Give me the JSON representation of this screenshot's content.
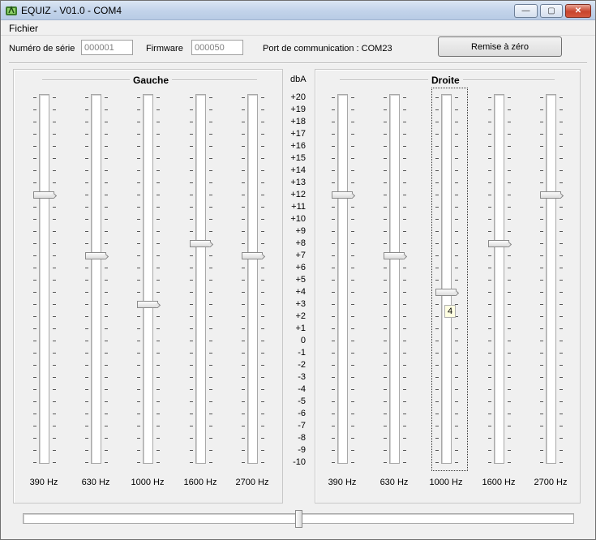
{
  "window": {
    "title": "EQUIZ - V01.0 - COM4",
    "min_glyph": "—",
    "max_glyph": "▢",
    "close_glyph": "✕"
  },
  "menu": {
    "file": "Fichier"
  },
  "info": {
    "serial_label": "Numéro de série",
    "serial_value": "000001",
    "firmware_label": "Firmware",
    "firmware_value": "000050",
    "port_label": "Port de communication : COM23",
    "reset_button": "Remise à zéro"
  },
  "scale": {
    "unit": "dbA",
    "labels": [
      "+20",
      "+19",
      "+18",
      "+17",
      "+16",
      "+15",
      "+14",
      "+13",
      "+12",
      "+11",
      "+10",
      "+9",
      "+8",
      "+7",
      "+6",
      "+5",
      "+4",
      "+3",
      "+2",
      "+1",
      "0",
      "-1",
      "-2",
      "-3",
      "-4",
      "-5",
      "-6",
      "-7",
      "-8",
      "-9",
      "-10"
    ],
    "max": 20,
    "min": -10
  },
  "left": {
    "title": "Gauche",
    "bands": [
      {
        "freq": "390 Hz",
        "value": 12
      },
      {
        "freq": "630 Hz",
        "value": 7
      },
      {
        "freq": "1000 Hz",
        "value": 3
      },
      {
        "freq": "1600 Hz",
        "value": 8
      },
      {
        "freq": "2700 Hz",
        "value": 7
      }
    ]
  },
  "right": {
    "title": "Droite",
    "bands": [
      {
        "freq": "390 Hz",
        "value": 12
      },
      {
        "freq": "630 Hz",
        "value": 7
      },
      {
        "freq": "1000 Hz",
        "value": 4,
        "focused": true,
        "tooltip": "4"
      },
      {
        "freq": "1600 Hz",
        "value": 8
      },
      {
        "freq": "2700 Hz",
        "value": 12
      }
    ]
  },
  "balance": {
    "value": 0.5
  }
}
